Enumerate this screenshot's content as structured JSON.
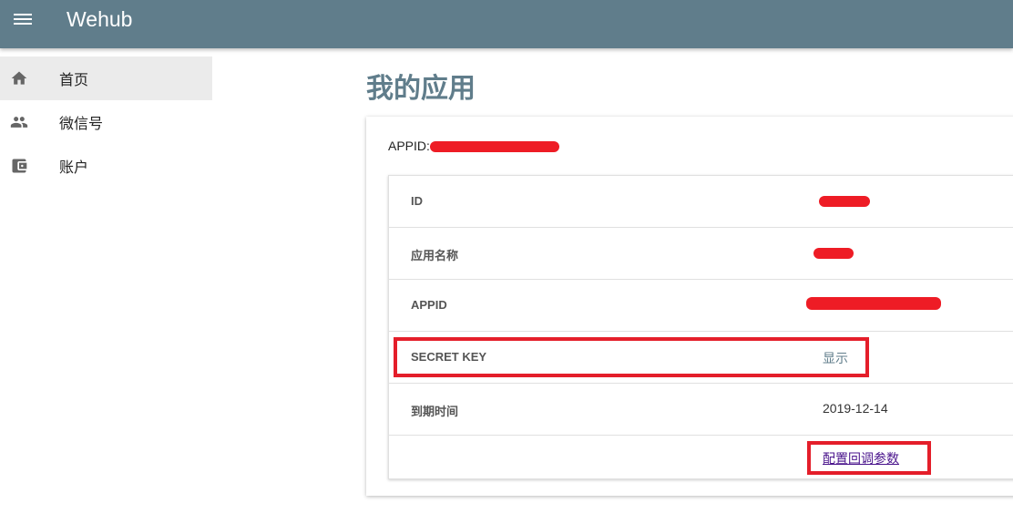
{
  "header": {
    "app_title": "Wehub",
    "menu_icon": "hamburger-menu-icon"
  },
  "sidebar": {
    "items": [
      {
        "label": "首页",
        "icon": "home-icon",
        "active": true
      },
      {
        "label": "微信号",
        "icon": "people-icon",
        "active": false
      },
      {
        "label": "账户",
        "icon": "wallet-icon",
        "active": false
      }
    ]
  },
  "main": {
    "title": "我的应用",
    "appid_label": "APPID:",
    "table": {
      "rows": [
        {
          "key": "ID",
          "value": ""
        },
        {
          "key": "应用名称",
          "value": ""
        },
        {
          "key": "APPID",
          "value": ""
        },
        {
          "key": "SECRET KEY",
          "value": "显示"
        },
        {
          "key": "到期时间",
          "value": "2019-12-14"
        },
        {
          "key": "",
          "value": "配置回调参数"
        }
      ]
    }
  },
  "colors": {
    "header": "#607d8b",
    "highlight": "#e41e2a",
    "redaction": "#ee1c25",
    "link": "#4a148c"
  }
}
